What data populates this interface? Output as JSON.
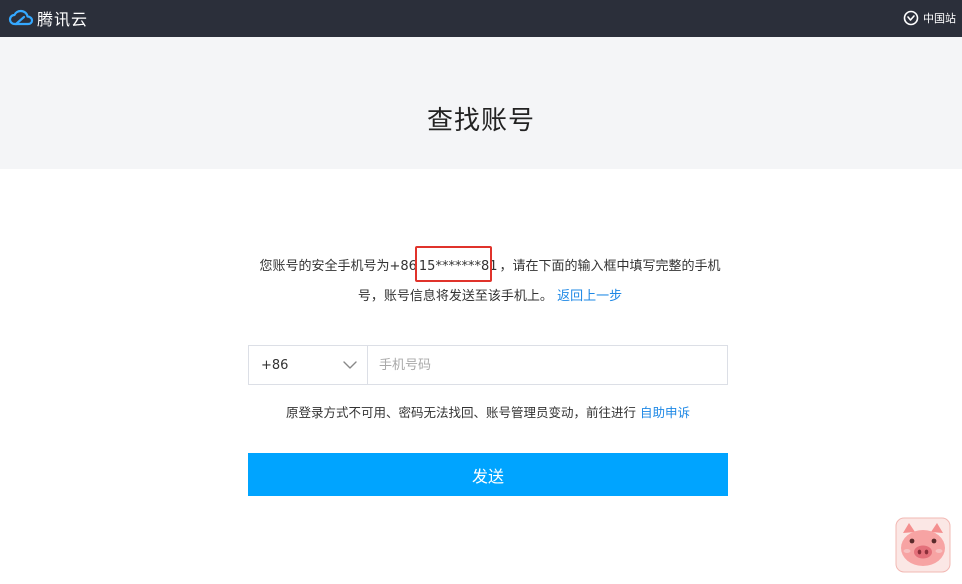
{
  "header": {
    "logo_text": "腾讯云",
    "region_label": "中国站",
    "bg_color": "#2b2f3a"
  },
  "page": {
    "title": "查找账号"
  },
  "message": {
    "prefix": "您账号的安全手机号为+86",
    "masked_number": "15*******81",
    "suffix": "，请在下面的输入框中填写完整的手机",
    "line2": "号，账号信息将发送至该手机上。",
    "back_link": "返回上一步"
  },
  "form": {
    "country_code": "+86",
    "phone_placeholder": "手机号码",
    "phone_value": ""
  },
  "appeal": {
    "text": "原登录方式不可用、密码无法找回、账号管理员变动，前往进行",
    "link": "自助申诉"
  },
  "actions": {
    "send_label": "发送",
    "send_color": "#00a4ff"
  },
  "colors": {
    "link": "#1e88e5",
    "highlight_box": "#e0332b"
  }
}
